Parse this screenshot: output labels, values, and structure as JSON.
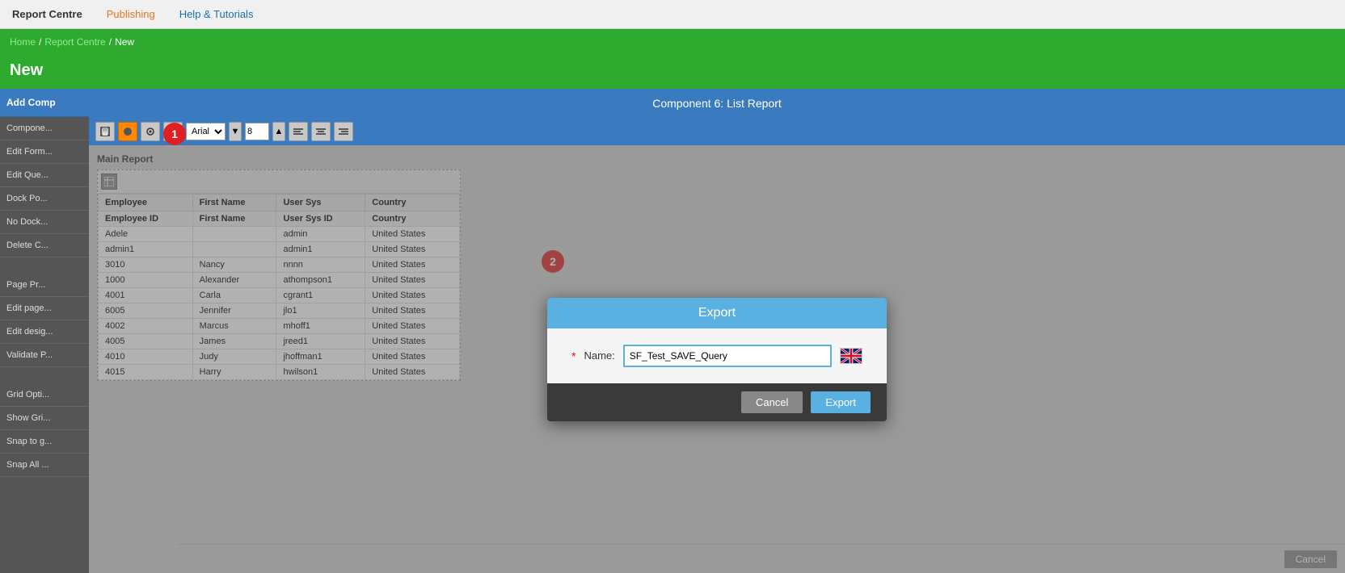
{
  "nav": {
    "report_centre": "Report Centre",
    "publishing": "Publishing",
    "help_tutorials": "Help & Tutorials"
  },
  "breadcrumb": {
    "home": "Home",
    "report_centre": "Report Centre",
    "new": "New"
  },
  "page": {
    "title": "New"
  },
  "sidebar": {
    "add_comp": "Add Comp",
    "component": "Compone...",
    "edit_form": "Edit Form...",
    "edit_query": "Edit Que...",
    "dock_po": "Dock Po...",
    "no_dock": "No Dock...",
    "delete_c": "Delete C...",
    "page_pr": "Page Pr...",
    "edit_page": "Edit page...",
    "edit_design": "Edit desig...",
    "validate": "Validate P...",
    "grid_opt": "Grid Opti...",
    "show_gri": "Show Gri...",
    "snap_to": "Snap to g...",
    "snap_all": "Snap All ..."
  },
  "component_header": {
    "title": "Component 6: List Report"
  },
  "toolbar": {
    "font": "Arial",
    "font_size": "8",
    "align_left": "≡",
    "align_center": "≡",
    "align_right": "≡"
  },
  "report": {
    "title": "Main Report",
    "columns": [
      "Employee",
      "First Name",
      "User Sys",
      "Country"
    ],
    "header_row": [
      "Employee ID",
      "First Name",
      "User Sys ID",
      "Country"
    ],
    "rows": [
      {
        "emp_id": "Adele",
        "first_name": "",
        "user_sys": "admin",
        "country": "United States"
      },
      {
        "emp_id": "admin1",
        "first_name": "",
        "user_sys": "admin1",
        "country": "United States"
      },
      {
        "emp_id": "3010",
        "first_name": "Nancy",
        "user_sys": "nnnn",
        "country": "United States"
      },
      {
        "emp_id": "1000",
        "first_name": "Alexander",
        "user_sys": "athompson1",
        "country": "United States"
      },
      {
        "emp_id": "4001",
        "first_name": "Carla",
        "user_sys": "cgrant1",
        "country": "United States"
      },
      {
        "emp_id": "6005",
        "first_name": "Jennifer",
        "user_sys": "jlo1",
        "country": "United States"
      },
      {
        "emp_id": "4002",
        "first_name": "Marcus",
        "user_sys": "mhoff1",
        "country": "United States"
      },
      {
        "emp_id": "4005",
        "first_name": "James",
        "user_sys": "jreed1",
        "country": "United States"
      },
      {
        "emp_id": "4010",
        "first_name": "Judy",
        "user_sys": "jhoffman1",
        "country": "United States"
      },
      {
        "emp_id": "4015",
        "first_name": "Harry",
        "user_sys": "hwilson1",
        "country": "United States"
      }
    ]
  },
  "badges": {
    "badge1": "1",
    "badge2": "2"
  },
  "export_dialog": {
    "title": "Export",
    "name_label": "Name:",
    "name_value": "SF_Test_SAVE_Query",
    "required_marker": "*",
    "cancel_label": "Cancel",
    "export_label": "Export"
  },
  "bottom": {
    "cancel_label": "Cancel"
  }
}
